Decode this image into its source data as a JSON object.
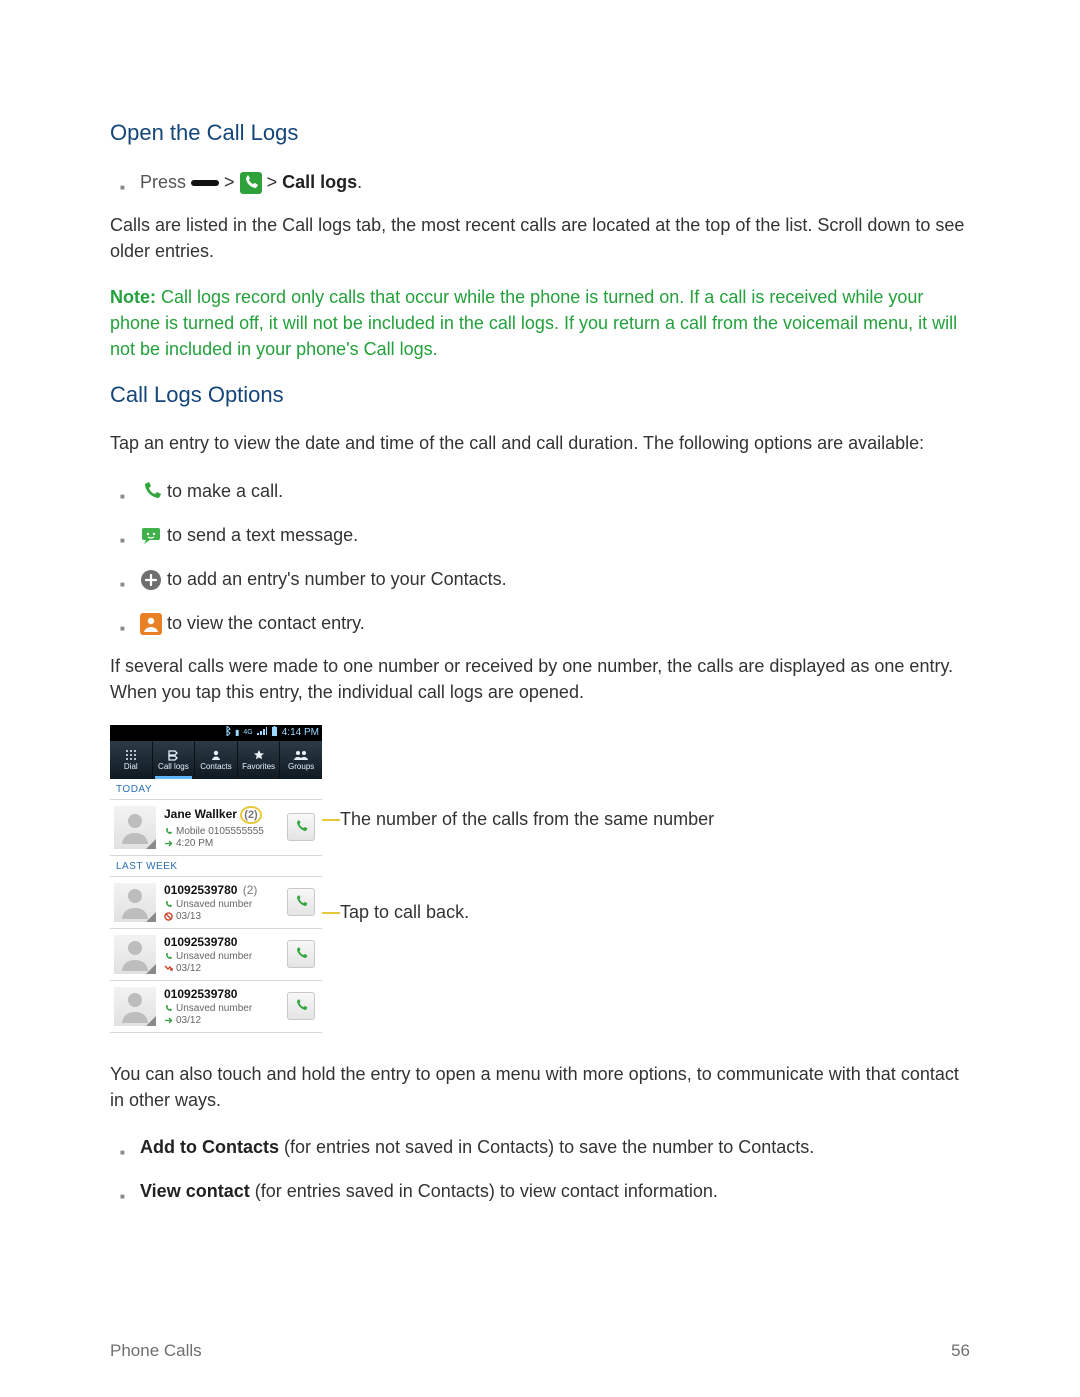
{
  "section1_title": "Open the Call Logs",
  "press_label": "Press",
  "gt": ">",
  "call_logs_label": "Call logs",
  "p_listed": "Calls are listed in the Call logs tab, the most recent calls are located at the top of the list. Scroll down to see older entries.",
  "note_prefix": "Note:",
  "note_body": "Call logs record only calls that occur while the phone is turned on. If a call is received while your phone is turned off, it will not be included in the call logs. If you return a call from the voicemail menu, it will not be included in your phone's Call logs.",
  "section2_title": "Call Logs Options",
  "p_tapentry": "Tap an entry to view the date and time of the call and call duration. The following options are available:",
  "opt_make_call": "to make a call.",
  "opt_send_text": "to send a text message.",
  "opt_add_contact": "to add an entry's number to your Contacts.",
  "opt_view_contact": "to view the contact entry.",
  "p_several": "If several calls were made to one number or received by one number, the calls are displayed as one entry. When you tap this entry, the individual call logs are opened.",
  "callout_count": "The number of the calls from the same number",
  "callout_callback": "Tap to call back.",
  "p_touchhold": "You can also touch and hold the entry to open a menu with more options, to communicate with that contact in other ways.",
  "opt_addto_label": "Add to Contacts",
  "opt_addto_rest": " (for entries not saved in Contacts) to save the number to Contacts.",
  "opt_viewc_label": "View contact",
  "opt_viewc_rest": " (for entries saved in Contacts) to view contact information.",
  "footer_left": "Phone Calls",
  "footer_right": "56",
  "phone": {
    "status_time": "4:14 PM",
    "tabs": {
      "dial": "Dial",
      "call_logs": "Call logs",
      "contacts": "Contacts",
      "favorites": "Favorites",
      "groups": "Groups"
    },
    "today": "TODAY",
    "lastweek": "LAST WEEK",
    "entries": {
      "e1": {
        "name": "Jane Wallker",
        "count": "(2)",
        "sub": "Mobile 0105555555",
        "time": "4:20 PM"
      },
      "e2": {
        "name": "01092539780",
        "count": "(2)",
        "sub": "Unsaved number",
        "time": "03/13"
      },
      "e3": {
        "name": "01092539780",
        "sub": "Unsaved number",
        "time": "03/12"
      },
      "e4": {
        "name": "01092539780",
        "sub": "Unsaved number",
        "time": "03/12"
      }
    }
  }
}
